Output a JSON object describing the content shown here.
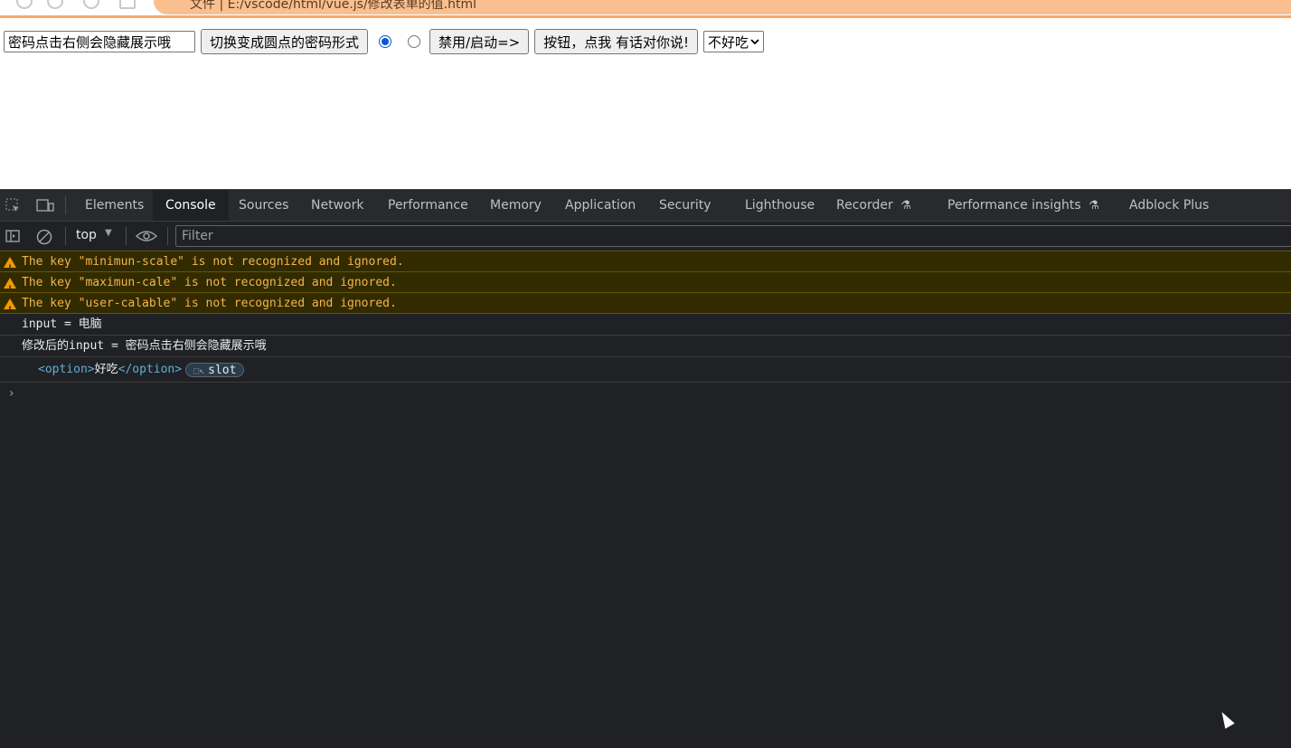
{
  "browser": {
    "address_text": "文件 | E:/vscode/html/vue.js/修改表单的值.html"
  },
  "page": {
    "password_input_value": "密码点击右侧会隐藏展示哦",
    "toggle_button_label": "切换变成圆点的密码形式",
    "radio_1_checked": true,
    "radio_2_checked": false,
    "disable_button_label": "禁用/启动=>",
    "talk_button_label": "按钮，点我 有话对你说!",
    "select_value": "不好吃"
  },
  "devtools": {
    "tabs": [
      {
        "label": "Elements"
      },
      {
        "label": "Console"
      },
      {
        "label": "Sources"
      },
      {
        "label": "Network"
      },
      {
        "label": "Performance"
      },
      {
        "label": "Memory"
      },
      {
        "label": "Application"
      },
      {
        "label": "Security"
      },
      {
        "label": "Lighthouse"
      },
      {
        "label": "Recorder"
      },
      {
        "label": "Performance insights"
      },
      {
        "label": "Adblock Plus"
      }
    ],
    "active_tab": "Console",
    "context": "top",
    "filter_placeholder": "Filter",
    "console": {
      "warnings": [
        "The key \"minimun-scale\" is not recognized and ignored.",
        "The key \"maximun-cale\" is not recognized and ignored.",
        "The key \"user-calable\" is not recognized and ignored."
      ],
      "logs": [
        "input = 电脑",
        "修改后的input = 密码点击右侧会隐藏展示哦"
      ],
      "element": {
        "open_tag": "<option>",
        "text": "好吃",
        "close_tag": "</option>",
        "badge": "slot"
      },
      "prompt": "›"
    },
    "colors": {
      "background": "#202124",
      "warning_bg": "#332b00",
      "warning_text": "#f2b54a",
      "tag_color": "#5db0d7"
    }
  }
}
